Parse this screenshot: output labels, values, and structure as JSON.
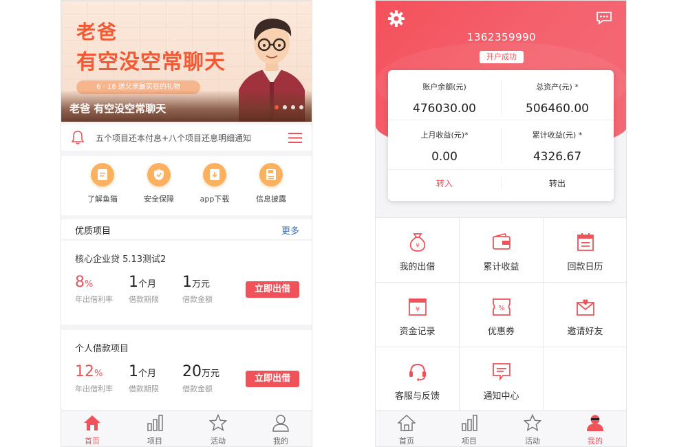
{
  "left": {
    "banner": {
      "line1": "老爸",
      "line2": "有空没空常聊天",
      "pill": "6 · 18 送父亲最实在的礼物",
      "caption": "老爸 有空没空常聊天",
      "dots_active_index": 0,
      "dots_count": 4
    },
    "notice": {
      "text": "五个项目还本付息+八个项目还息明细通知",
      "bell_icon": "bell-icon",
      "menu_icon": "list-icon"
    },
    "quick_links": [
      {
        "label": "了解鱼猫",
        "icon": "document-icon"
      },
      {
        "label": "安全保障",
        "icon": "shield-check-icon"
      },
      {
        "label": "app下载",
        "icon": "download-icon"
      },
      {
        "label": "信息披露",
        "icon": "save-disk-icon"
      }
    ],
    "section": {
      "title": "优质项目",
      "more": "更多"
    },
    "projects": [
      {
        "name": "核心企业贷 5.13测试2",
        "rate_value": "8",
        "rate_unit": "%",
        "rate_label": "年出借利率",
        "term_value": "1",
        "term_unit": "个月",
        "term_label": "借款期限",
        "amount_value": "1",
        "amount_unit": "万元",
        "amount_label": "借款金额",
        "button": "立即出借"
      },
      {
        "name": "个人借款项目",
        "rate_value": "12",
        "rate_unit": "%",
        "rate_label": "年出借利率",
        "term_value": "1",
        "term_unit": "个月",
        "term_label": "借款期限",
        "amount_value": "20",
        "amount_unit": "万元",
        "amount_label": "借款金额",
        "button": "立即出借"
      }
    ],
    "tabs": [
      {
        "label": "首页",
        "icon": "home-icon",
        "active": true
      },
      {
        "label": "项目",
        "icon": "bar-chart-icon",
        "active": false
      },
      {
        "label": "活动",
        "icon": "star-icon",
        "active": false
      },
      {
        "label": "我的",
        "icon": "user-icon",
        "active": false
      }
    ]
  },
  "right": {
    "phone": "1362359990",
    "badge": "开户成功",
    "settings_icon": "gear-icon",
    "message_icon": "message-icon",
    "account": {
      "balance_label": "账户余额(元)",
      "balance_value": "476030.00",
      "total_label": "总资产(元) *",
      "total_value": "506460.00",
      "last_month_label": "上月收益(元)*",
      "last_month_value": "0.00",
      "cumulative_label": "累计收益(元) *",
      "cumulative_value": "4326.67",
      "deposit": "转入",
      "withdraw": "转出"
    },
    "grid": [
      {
        "label": "我的出借",
        "icon": "money-bag-icon"
      },
      {
        "label": "累计收益",
        "icon": "wallet-icon"
      },
      {
        "label": "回款日历",
        "icon": "calendar-icon"
      },
      {
        "label": "资金记录",
        "icon": "cash-box-icon"
      },
      {
        "label": "优惠券",
        "icon": "coupon-icon"
      },
      {
        "label": "邀请好友",
        "icon": "invite-envelope-icon"
      },
      {
        "label": "客服与反馈",
        "icon": "headset-icon"
      },
      {
        "label": "通知中心",
        "icon": "notice-icon"
      }
    ],
    "tabs": [
      {
        "label": "首页",
        "icon": "home-icon",
        "active": false
      },
      {
        "label": "项目",
        "icon": "bar-chart-icon",
        "active": false
      },
      {
        "label": "活动",
        "icon": "star-icon",
        "active": false
      },
      {
        "label": "我的",
        "icon": "user-icon",
        "active": true
      }
    ]
  },
  "colors": {
    "accent_red": "#f0525a",
    "banner_orange": "#f15a35",
    "quick_icon_orange": "#fbb15f",
    "link_blue": "#3e6fb4"
  }
}
